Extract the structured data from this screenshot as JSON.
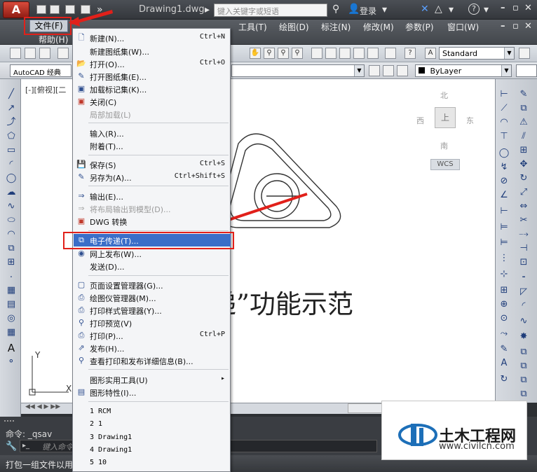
{
  "app": {
    "logo_letter": "A",
    "document_title": "Drawing1.dwg",
    "search_placeholder": "键入关键字或短语",
    "login_label": "登录",
    "help_icon": "?"
  },
  "menubar": {
    "items": [
      "文件(F)",
      "工具(T)",
      "绘图(D)",
      "标注(N)",
      "修改(M)",
      "参数(P)",
      "窗口(W)",
      "帮助(H)"
    ]
  },
  "toolbars": {
    "workspace": "AutoCAD 经典",
    "text_style": "Standard",
    "layer": "ByLayer"
  },
  "viewport": {
    "label": "[-][俯视][二",
    "compass_north": "北",
    "compass_south": "南",
    "compass_east": "东",
    "compass_west": "西",
    "cube_face": "上",
    "wcs": "WCS",
    "caption": "递”功能示范",
    "ucs_y": "Y",
    "ucs_x": "X"
  },
  "command": {
    "history": "命令: _qsav",
    "prompt": "键入命令",
    "status_text": "打包一组文件以用于"
  },
  "file_menu": {
    "items": [
      {
        "label": "新建(N)...",
        "shortcut": "Ctrl+N",
        "icon": "new-file-icon"
      },
      {
        "label": "新建图纸集(W)...",
        "shortcut": "",
        "icon": ""
      },
      {
        "label": "打开(O)...",
        "shortcut": "Ctrl+O",
        "icon": "open-folder-icon"
      },
      {
        "label": "打开图纸集(E)...",
        "shortcut": "",
        "icon": "open-sheetset-icon"
      },
      {
        "label": "加载标记集(K)...",
        "shortcut": "",
        "icon": "markup-icon"
      },
      {
        "label": "关闭(C)",
        "shortcut": "",
        "icon": "close-doc-icon"
      },
      {
        "label": "局部加载(L)",
        "shortcut": "",
        "icon": "",
        "disabled": true
      },
      {
        "label": "输入(R)...",
        "shortcut": "",
        "icon": ""
      },
      {
        "label": "附着(T)...",
        "shortcut": "",
        "icon": ""
      },
      {
        "label": "保存(S)",
        "shortcut": "Ctrl+S",
        "icon": "save-icon"
      },
      {
        "label": "另存为(A)...",
        "shortcut": "Ctrl+Shift+S",
        "icon": "save-as-icon"
      },
      {
        "label": "输出(E)...",
        "shortcut": "",
        "icon": "export-icon"
      },
      {
        "label": "将布局输出到模型(D)...",
        "shortcut": "",
        "icon": "export-layout-icon",
        "disabled": true
      },
      {
        "label": "DWG 转换",
        "shortcut": "",
        "icon": "dwg-convert-icon"
      },
      {
        "label": "电子传递(T)...",
        "shortcut": "",
        "icon": "etransmit-icon",
        "highlighted": true
      },
      {
        "label": "网上发布(W)...",
        "shortcut": "",
        "icon": "publish-web-icon"
      },
      {
        "label": "发送(D)...",
        "shortcut": "",
        "icon": ""
      },
      {
        "label": "页面设置管理器(G)...",
        "shortcut": "",
        "icon": "page-setup-icon"
      },
      {
        "label": "绘图仪管理器(M)...",
        "shortcut": "",
        "icon": "plotter-icon"
      },
      {
        "label": "打印样式管理器(Y)...",
        "shortcut": "",
        "icon": "plot-style-icon"
      },
      {
        "label": "打印预览(V)",
        "shortcut": "",
        "icon": "plot-preview-icon"
      },
      {
        "label": "打印(P)...",
        "shortcut": "Ctrl+P",
        "icon": "print-icon"
      },
      {
        "label": "发布(H)...",
        "shortcut": "",
        "icon": "publish-icon"
      },
      {
        "label": "查看打印和发布详细信息(B)...",
        "shortcut": "",
        "icon": "plot-details-icon"
      },
      {
        "label": "图形实用工具(U)",
        "shortcut": "▸",
        "icon": ""
      },
      {
        "label": "图形特性(I)...",
        "shortcut": "",
        "icon": "drawing-properties-icon"
      }
    ],
    "recent_files": [
      "1 RCM",
      "2 1",
      "3 Drawing1",
      "4 Drawing1",
      "5 10"
    ]
  },
  "watermark": {
    "title": "土木工程网",
    "url": "www.civilcn.com"
  },
  "colors": {
    "highlight": "#3a6ec8",
    "annotation_red": "#e1201a",
    "logo_red": "#c0392b"
  }
}
